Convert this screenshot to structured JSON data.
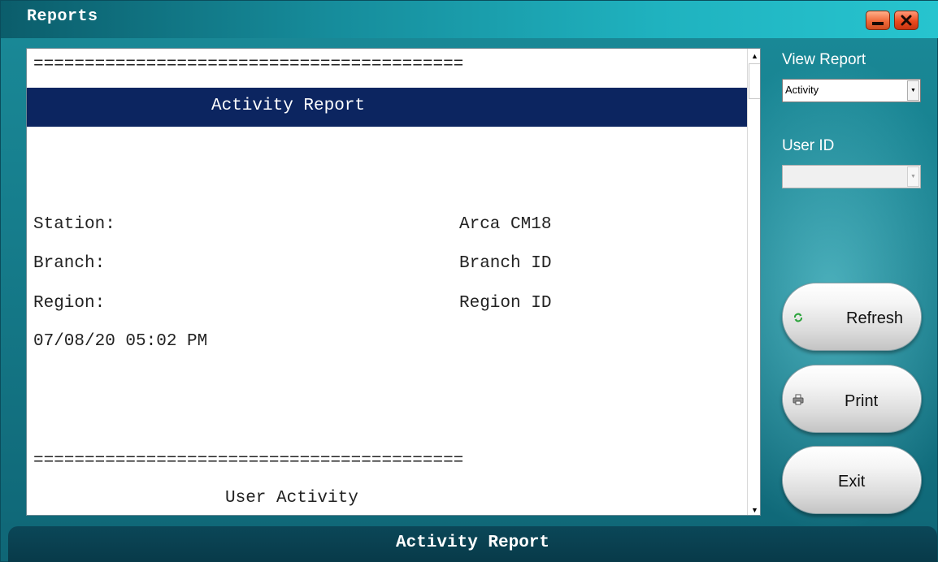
{
  "window": {
    "title": "Reports",
    "minimize_icon": "minimize-icon",
    "close_icon": "close-icon",
    "colors": {
      "title_accent": "#27c4cf",
      "close_button": "#ec4b1e",
      "report_header_band": "#0c2560"
    }
  },
  "report": {
    "lines": [
      "==========================================",
      "Activity Report",
      "Station:",
      "Arca CM18",
      "Branch:",
      "Branch ID",
      "Region:",
      "Region ID",
      "07/08/20 05:02 PM",
      "==========================================",
      "User Activity"
    ]
  },
  "sidebar": {
    "view_report_label": "View Report",
    "view_report_selected": "Activity",
    "user_id_label": "User ID",
    "user_id_selected": "",
    "refresh_label": "Refresh",
    "refresh_icon": "refresh-icon",
    "print_label": "Print",
    "print_icon": "printer-icon",
    "exit_label": "Exit"
  },
  "status": {
    "text": "Activity Report"
  }
}
